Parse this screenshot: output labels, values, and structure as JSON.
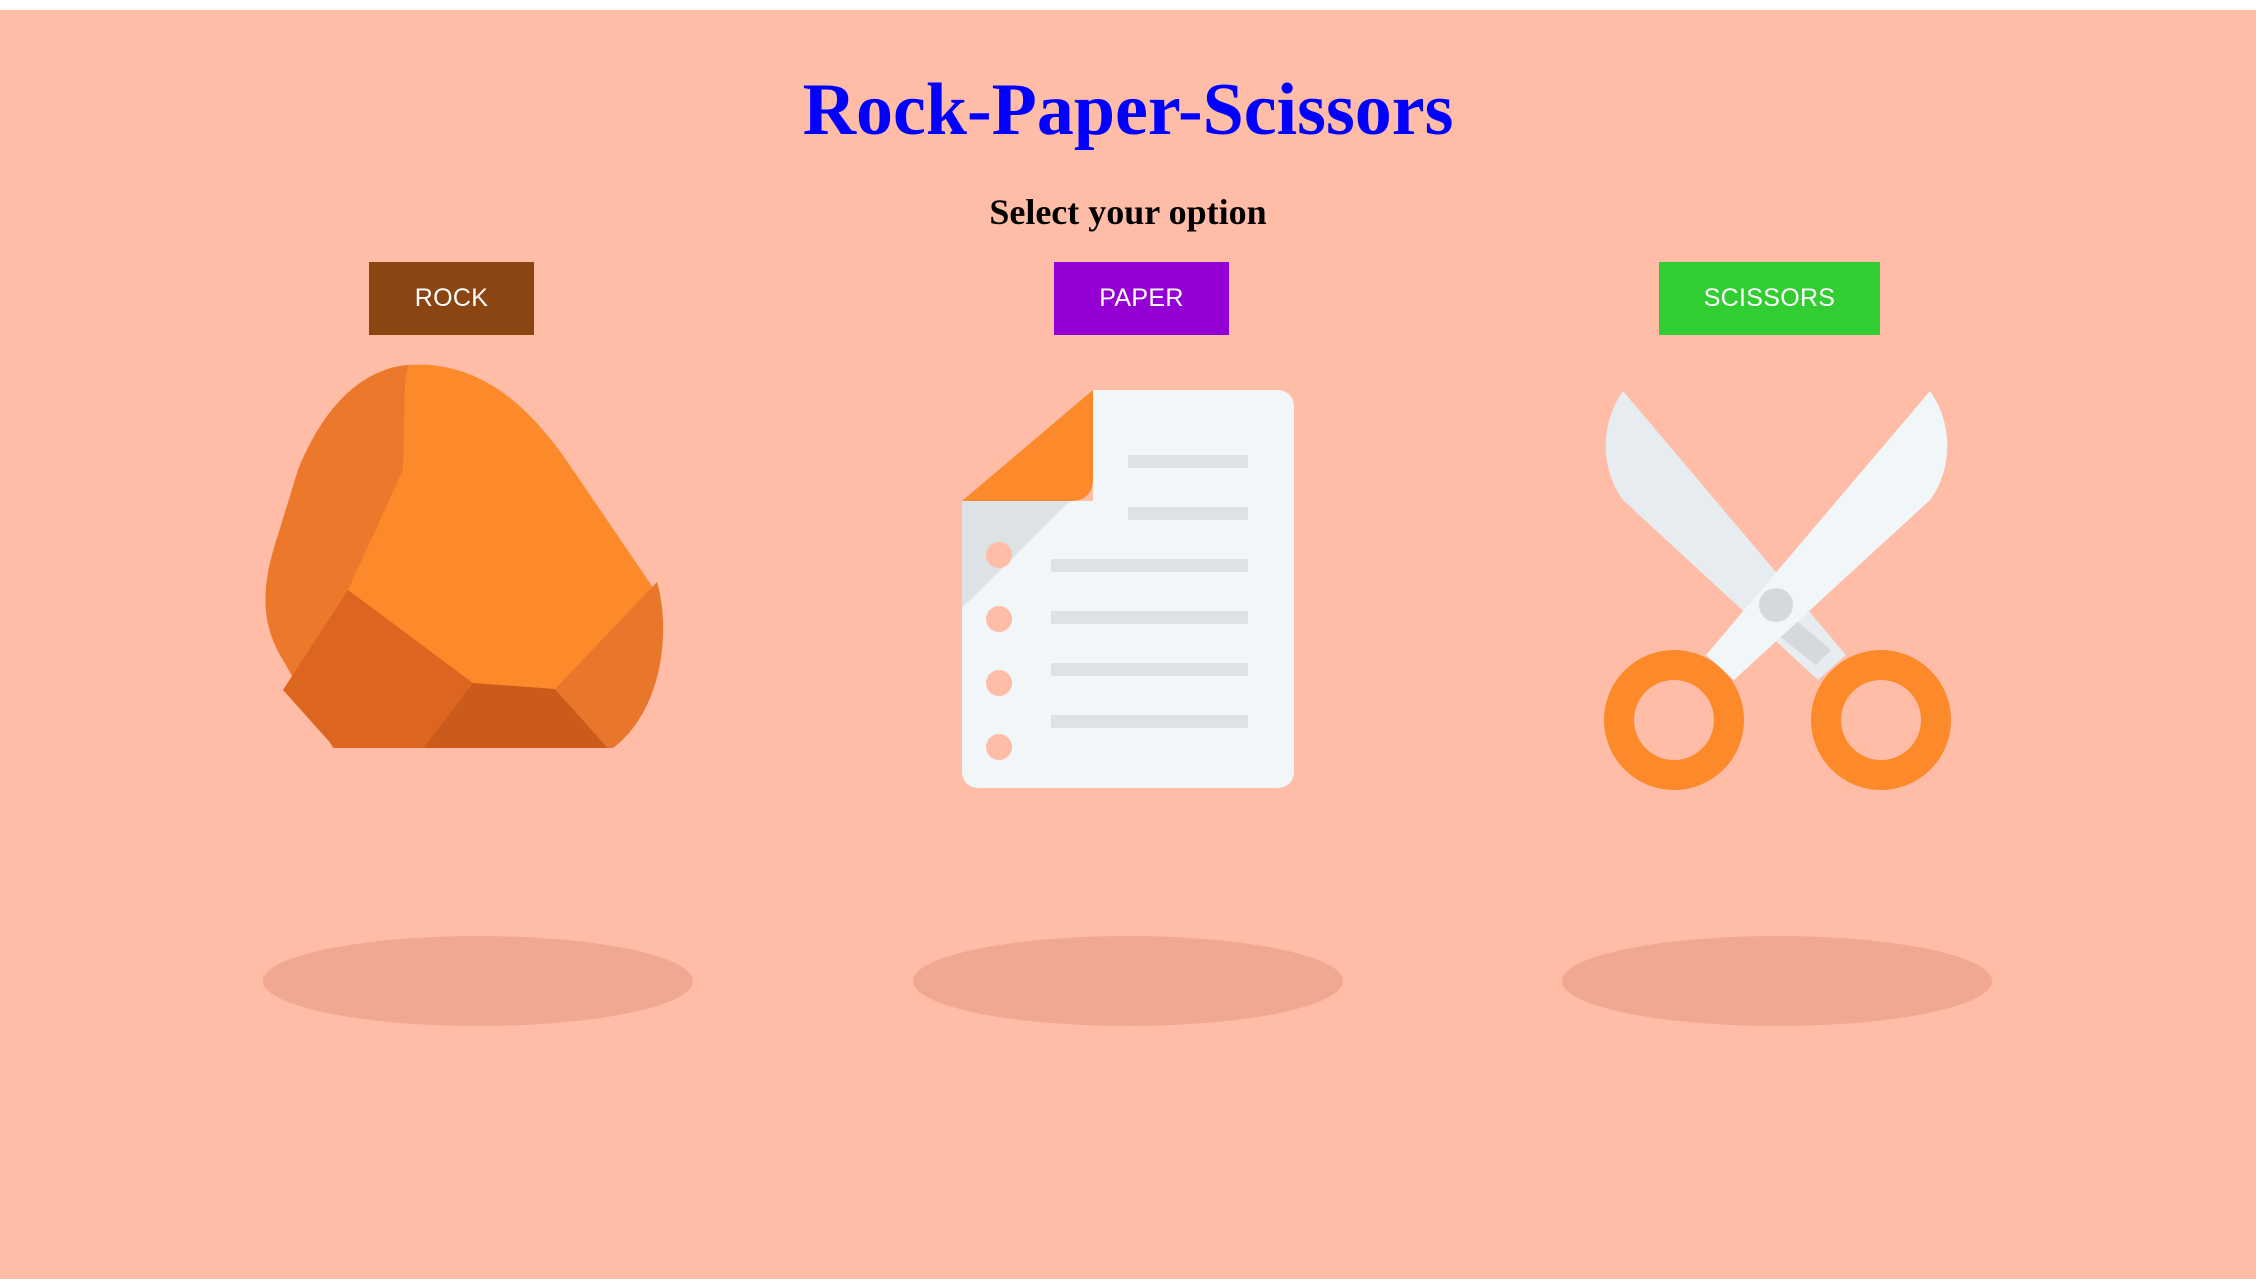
{
  "header": {
    "title": "Rock-Paper-Scissors",
    "subtitle": "Select your option"
  },
  "options": [
    {
      "label": "ROCK",
      "color": "#8b4513",
      "icon": "rock-icon"
    },
    {
      "label": "PAPER",
      "color": "#9400d3",
      "icon": "paper-document-icon"
    },
    {
      "label": "SCISSORS",
      "color": "#32cd32",
      "icon": "scissors-icon"
    }
  ],
  "colors": {
    "background": "#ffbca6",
    "title": "#0000ff",
    "shadow": "#f0a990",
    "illustration_orange": "#fc8a2b"
  }
}
